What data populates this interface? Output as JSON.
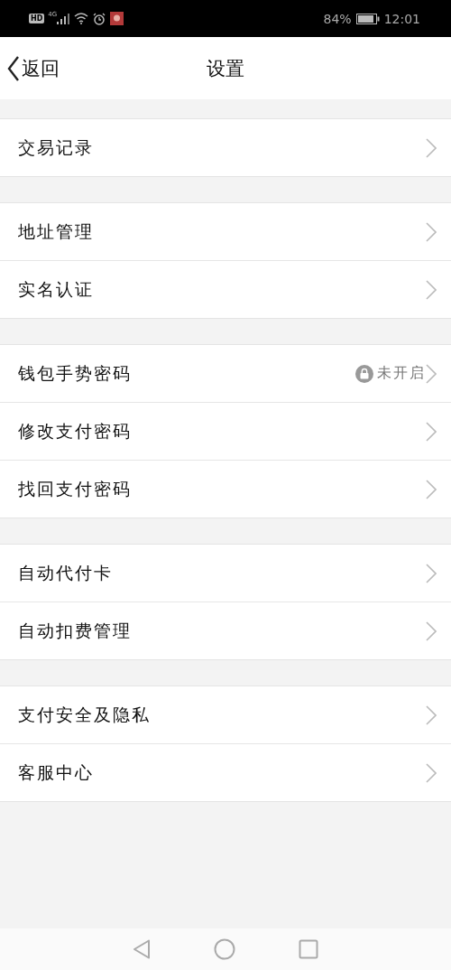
{
  "status_bar": {
    "hd": "HD",
    "network": "4G",
    "battery_text": "84%",
    "time": "12:01"
  },
  "header": {
    "back": "返回",
    "title": "设置"
  },
  "sections": [
    {
      "items": [
        {
          "label": "交易记录"
        }
      ]
    },
    {
      "items": [
        {
          "label": "地址管理"
        },
        {
          "label": "实名认证"
        }
      ]
    },
    {
      "items": [
        {
          "label": "钱包手势密码",
          "status": "未开启"
        },
        {
          "label": "修改支付密码"
        },
        {
          "label": "找回支付密码"
        }
      ]
    },
    {
      "items": [
        {
          "label": "自动代付卡"
        },
        {
          "label": "自动扣费管理"
        }
      ]
    },
    {
      "items": [
        {
          "label": "支付安全及隐私"
        },
        {
          "label": "客服中心"
        }
      ]
    }
  ]
}
